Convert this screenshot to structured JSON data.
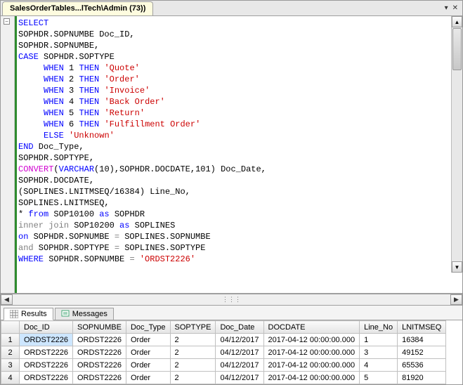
{
  "tab": {
    "title": "SalesOrderTables...lTech\\Admin (73))"
  },
  "window_controls": {
    "dropdown": "▾",
    "close": "✕"
  },
  "sql": {
    "l01a": "SELECT",
    "l02": "SOPHDR.SOPNUMBE Doc_ID,",
    "l03": "SOPHDR.SOPNUMBE,",
    "l04a": "CASE",
    "l04b": " SOPHDR.SOPTYPE",
    "l05a": "WHEN",
    "l05b": " 1 ",
    "l05c": "THEN",
    "l05d": " ",
    "l05e": "'Quote'",
    "l06a": "WHEN",
    "l06b": " 2 ",
    "l06c": "THEN",
    "l06d": " ",
    "l06e": "'Order'",
    "l07a": "WHEN",
    "l07b": " 3 ",
    "l07c": "THEN",
    "l07d": " ",
    "l07e": "'Invoice'",
    "l08a": "WHEN",
    "l08b": " 4 ",
    "l08c": "THEN",
    "l08d": " ",
    "l08e": "'Back Order'",
    "l09a": "WHEN",
    "l09b": " 5 ",
    "l09c": "THEN",
    "l09d": " ",
    "l09e": "'Return'",
    "l10a": "WHEN",
    "l10b": " 6 ",
    "l10c": "THEN",
    "l10d": " ",
    "l10e": "'Fulfillment Order'",
    "l11a": "ELSE",
    "l11b": " ",
    "l11c": "'Unknown'",
    "l12a": "END",
    "l12b": " Doc_Type,",
    "l13": "SOPHDR.SOPTYPE,",
    "l14a": "CONVERT",
    "l14b": "(",
    "l14c": "VARCHAR",
    "l14d": "(10),SOPHDR.DOCDATE,101) Doc_Date,",
    "l15": "SOPHDR.DOCDATE,",
    "l16": "(SOPLINES.LNITMSEQ/16384) Line_No,",
    "l17": "SOPLINES.LNITMSEQ,",
    "l18a": "* ",
    "l18b": "from",
    "l18c": " SOP10100 ",
    "l18d": "as",
    "l18e": " SOPHDR",
    "l19a": "inner",
    "l19b": " ",
    "l19c": "join",
    "l19d": " SOP10200 ",
    "l19e": "as",
    "l19f": " SOPLINES",
    "l20a": "on",
    "l20b": " SOPHDR.SOPNUMBE ",
    "l20c": "=",
    "l20d": " SOPLINES.SOPNUMBE",
    "l21a": "and",
    "l21b": " SOPHDR.SOPTYPE ",
    "l21c": "=",
    "l21d": " SOPLINES.SOPTYPE",
    "l22a": "WHERE",
    "l22b": " SOPHDR.SOPNUMBE ",
    "l22c": "=",
    "l22d": " ",
    "l22e": "'ORDST2226'"
  },
  "scroll": {
    "left": "◀",
    "right": "▶",
    "up": "▲",
    "down": "▼",
    "grip": "⋮⋮⋮"
  },
  "result_tabs": {
    "results": "Results",
    "messages": "Messages"
  },
  "grid": {
    "columns": [
      "",
      "Doc_ID",
      "SOPNUMBE",
      "Doc_Type",
      "SOPTYPE",
      "Doc_Date",
      "DOCDATE",
      "Line_No",
      "LNITMSEQ"
    ],
    "rows": [
      {
        "n": "1",
        "c": [
          "ORDST2226",
          "ORDST2226",
          "Order",
          "2",
          "04/12/2017",
          "2017-04-12 00:00:00.000",
          "1",
          "16384"
        ]
      },
      {
        "n": "2",
        "c": [
          "ORDST2226",
          "ORDST2226",
          "Order",
          "2",
          "04/12/2017",
          "2017-04-12 00:00:00.000",
          "3",
          "49152"
        ]
      },
      {
        "n": "3",
        "c": [
          "ORDST2226",
          "ORDST2226",
          "Order",
          "2",
          "04/12/2017",
          "2017-04-12 00:00:00.000",
          "4",
          "65536"
        ]
      },
      {
        "n": "4",
        "c": [
          "ORDST2226",
          "ORDST2226",
          "Order",
          "2",
          "04/12/2017",
          "2017-04-12 00:00:00.000",
          "5",
          "81920"
        ]
      }
    ]
  }
}
